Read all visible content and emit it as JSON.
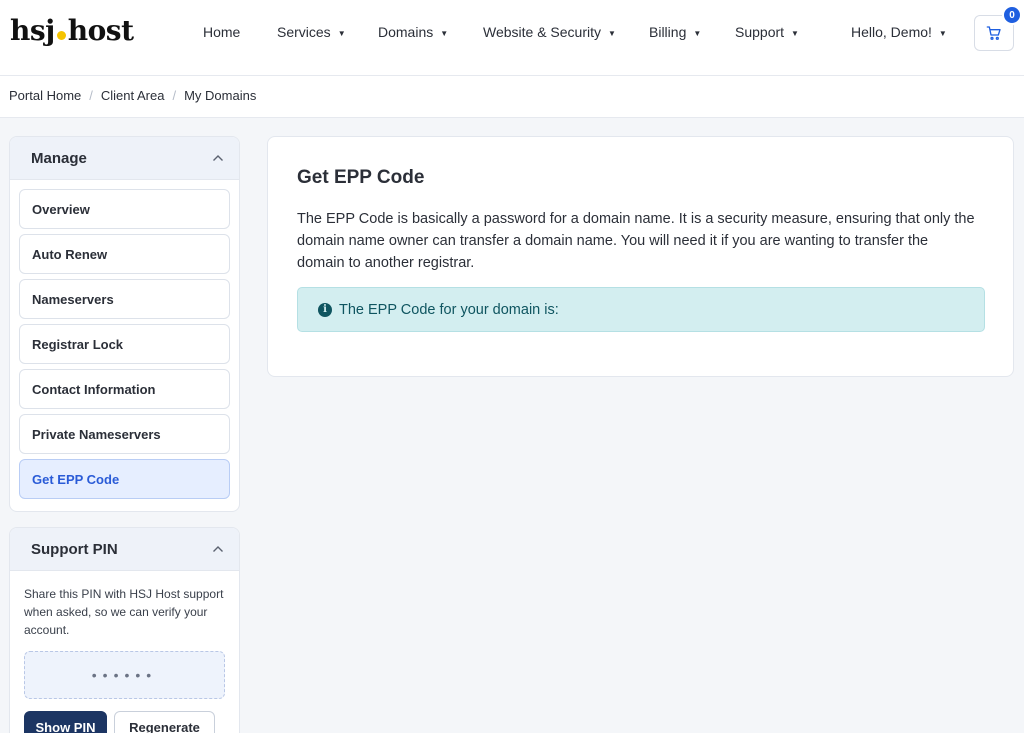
{
  "logo": {
    "left": "hsj",
    "right": "host"
  },
  "nav": {
    "home": "Home",
    "services": "Services",
    "domains": "Domains",
    "website_security": "Website & Security",
    "billing": "Billing",
    "support": "Support",
    "account": "Hello, Demo!"
  },
  "cart": {
    "count": "0",
    "icon": "cart-icon"
  },
  "breadcrumb": [
    "Portal Home",
    "Client Area",
    "My Domains"
  ],
  "sidebar": {
    "manage": {
      "title": "Manage",
      "items": [
        {
          "label": "Overview",
          "active": false
        },
        {
          "label": "Auto Renew",
          "active": false
        },
        {
          "label": "Nameservers",
          "active": false
        },
        {
          "label": "Registrar Lock",
          "active": false
        },
        {
          "label": "Contact Information",
          "active": false
        },
        {
          "label": "Private Nameservers",
          "active": false
        },
        {
          "label": "Get EPP Code",
          "active": true
        }
      ]
    },
    "support_pin": {
      "title": "Support PIN",
      "description": "Share this PIN with HSJ Host support when asked, so we can verify your account.",
      "masked_pin": "••••••",
      "show_button": "Show PIN",
      "regenerate_button": "Regenerate"
    }
  },
  "main": {
    "title": "Get EPP Code",
    "description": "The EPP Code is basically a password for a domain name. It is a security measure, ensuring that only the domain name owner can transfer a domain name. You will need it if you are wanting to transfer the domain to another registrar.",
    "alert": "The EPP Code for your domain is:"
  },
  "colors": {
    "accent": "#1f5fe0",
    "active_item_bg": "#e6eeff",
    "alert_bg": "#d3eef0",
    "primary_button": "#1c3563",
    "logo_dot": "#f5c400"
  }
}
